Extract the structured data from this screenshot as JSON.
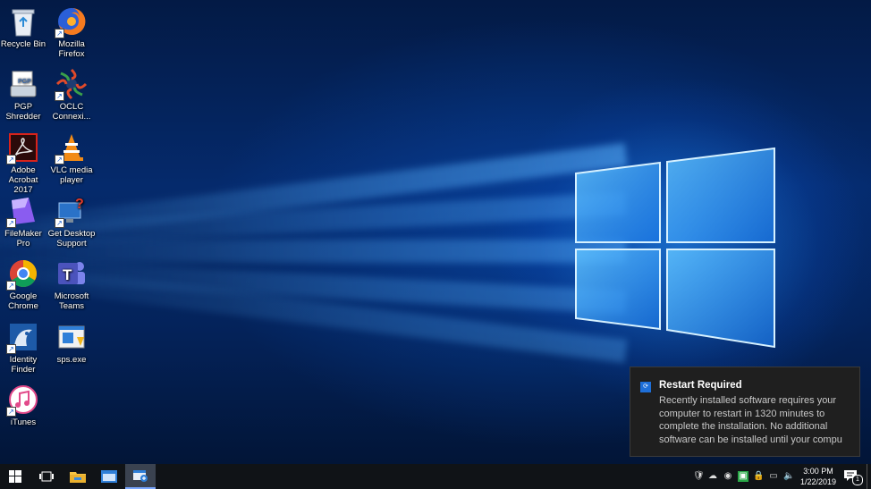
{
  "desktop_icons": [
    {
      "label": "Recycle Bin",
      "icon": "recycle-bin-icon"
    },
    {
      "label": "Mozilla Firefox",
      "icon": "firefox-icon"
    },
    {
      "label": "PGP Shredder",
      "icon": "pgp-shredder-icon"
    },
    {
      "label": "OCLC Connexi...",
      "icon": "oclc-connexion-icon"
    },
    {
      "label": "Adobe Acrobat 2017",
      "icon": "acrobat-icon"
    },
    {
      "label": "VLC media player",
      "icon": "vlc-icon"
    },
    {
      "label": "FileMaker Pro",
      "icon": "filemaker-icon"
    },
    {
      "label": "Get Desktop Support",
      "icon": "desktop-support-icon"
    },
    {
      "label": "Google Chrome",
      "icon": "chrome-icon"
    },
    {
      "label": "Microsoft Teams",
      "icon": "teams-icon"
    },
    {
      "label": "Identity Finder",
      "icon": "identity-finder-icon"
    },
    {
      "label": "sps.exe",
      "icon": "sps-exe-icon"
    },
    {
      "label": "iTunes",
      "icon": "itunes-icon"
    }
  ],
  "toast": {
    "title": "Restart Required",
    "body": "Recently installed software requires your computer to restart in 1320 minutes to complete the installation. No additional software can be installed until your compu"
  },
  "taskbar": {
    "buttons": [
      "start-icon",
      "task-view-icon",
      "file-explorer-icon",
      "app-window-icon",
      "software-center-icon"
    ],
    "tray": [
      "defender-icon",
      "onedrive-icon",
      "network-globe-icon",
      "green-app-icon",
      "lock-icon",
      "network-icon",
      "volume-icon"
    ],
    "time": "3:00 PM",
    "date": "1/22/2019",
    "notification_count": "1"
  },
  "colors": {
    "accent": "#1e6fd9",
    "taskbar": "#101317",
    "toast": "#1f1f1f"
  }
}
